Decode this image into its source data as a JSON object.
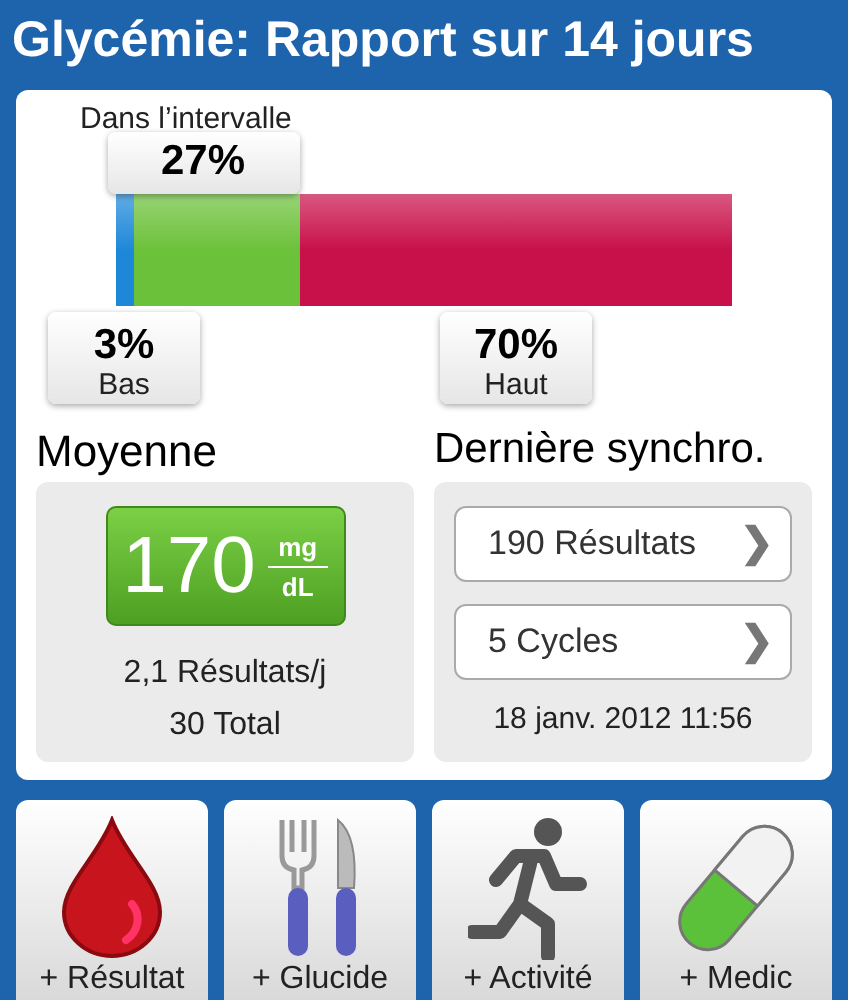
{
  "title": "Glycémie: Rapport sur 14 jours",
  "range_bar": {
    "segments": [
      {
        "kind": "low",
        "value": "3%",
        "label": "Bas",
        "color": "#1e88d8"
      },
      {
        "kind": "in_range",
        "value": "27%",
        "label": "Dans l’intervalle",
        "color": "#6cc13a"
      },
      {
        "kind": "high",
        "value": "70%",
        "label": "Haut",
        "color": "#c8104a"
      }
    ]
  },
  "average": {
    "heading": "Moyenne",
    "value": "170",
    "unit_top": "mg",
    "unit_bottom": "dL",
    "per_day": "2,1 Résultats/j",
    "total": "30 Total"
  },
  "last_sync": {
    "heading": "Dernière synchro.",
    "links": [
      "190 Résultats",
      "5 Cycles"
    ],
    "chevron": "❯",
    "date": "18 janv. 2012 11:56"
  },
  "actions": [
    {
      "kind": "drop",
      "label": "+ Résultat"
    },
    {
      "kind": "cutlery",
      "label": "+ Glucide"
    },
    {
      "kind": "runner",
      "label": "+ Activité"
    },
    {
      "kind": "pill",
      "label": "+ Medic"
    }
  ]
}
